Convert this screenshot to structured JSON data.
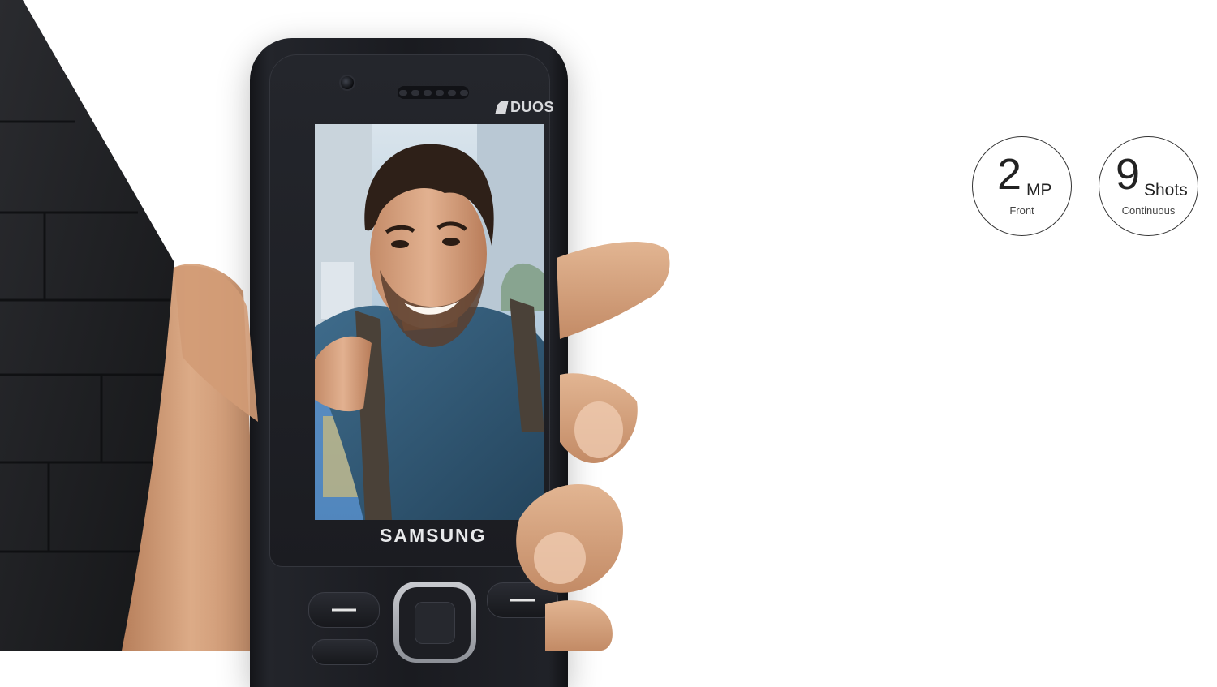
{
  "phone": {
    "brand": "SAMSUNG",
    "sim_label": "DUOS"
  },
  "badges": [
    {
      "value": "2",
      "unit": "MP",
      "caption": "Front"
    },
    {
      "value": "9",
      "unit": "Shots",
      "caption": "Continuous"
    }
  ],
  "colors": {
    "slate": "#1e1f22",
    "phone_body": "#1a1b20",
    "skin": "#d9a884",
    "badge_border": "#333333"
  }
}
